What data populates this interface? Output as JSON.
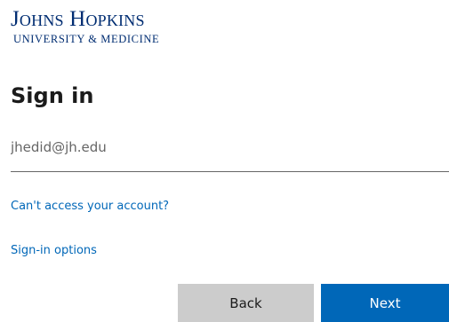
{
  "logo": {
    "main": "Johns Hopkins",
    "sub": "UNIVERSITY & MEDICINE"
  },
  "form": {
    "title": "Sign in",
    "email_placeholder": "jhedid@jh.edu",
    "email_value": ""
  },
  "links": {
    "cant_access": "Can't access your account?",
    "signin_options": "Sign-in options"
  },
  "buttons": {
    "back": "Back",
    "next": "Next"
  },
  "colors": {
    "brand_blue": "#002d72",
    "link_blue": "#0067b8",
    "primary_button": "#0067b8",
    "secondary_button": "#cccccc"
  }
}
